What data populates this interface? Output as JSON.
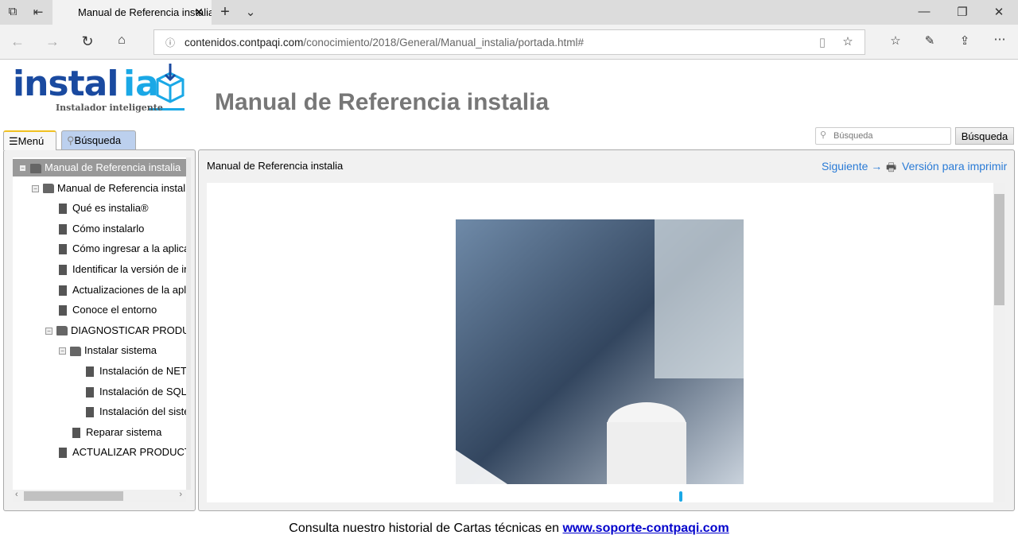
{
  "browser": {
    "tab_title": "Manual de Referencia instalia",
    "url_domain": "contenidos.contpaqi.com",
    "url_path": "/conocimiento/2018/General/Manual_instalia/portada.html#"
  },
  "logo": {
    "word": "instalia",
    "tagline": "Instalador inteligente"
  },
  "page_title": "Manual de Referencia instalia",
  "panel_tabs": {
    "menu": "Menú",
    "search": "Búsqueda"
  },
  "search": {
    "placeholder": "Búsqueda",
    "button": "Búsqueda"
  },
  "tree": [
    {
      "label": "Manual de Referencia instalia",
      "type": "book",
      "level": 0,
      "selected": true
    },
    {
      "label": "Manual de Referencia instalia",
      "type": "book",
      "level": 1
    },
    {
      "label": "Qué es instalia®",
      "type": "page",
      "level": 2
    },
    {
      "label": "Cómo instalarlo",
      "type": "page",
      "level": 2
    },
    {
      "label": "Cómo ingresar a la aplicación",
      "type": "page",
      "level": 2
    },
    {
      "label": "Identificar la versión de instalia",
      "type": "page",
      "level": 2
    },
    {
      "label": "Actualizaciones de la aplicación",
      "type": "page",
      "level": 2
    },
    {
      "label": "Conoce el entorno",
      "type": "page",
      "level": 2
    },
    {
      "label": "DIAGNOSTICAR PRODUCTOS",
      "type": "book",
      "level": 2
    },
    {
      "label": "Instalar sistema",
      "type": "book",
      "level": 3
    },
    {
      "label": "Instalación de NET",
      "type": "page",
      "level": 4
    },
    {
      "label": "Instalación de SQL",
      "type": "page",
      "level": 4
    },
    {
      "label": "Instalación del sistema",
      "type": "page",
      "level": 4
    },
    {
      "label": "Reparar sistema",
      "type": "page",
      "level": 3
    },
    {
      "label": "ACTUALIZAR PRODUCTOS",
      "type": "page",
      "level": 2
    }
  ],
  "content": {
    "breadcrumb": "Manual de Referencia instalia",
    "next": "Siguiente →",
    "print": "Versión para imprimir"
  },
  "footer": {
    "text": "Consulta nuestro historial de Cartas técnicas en ",
    "link": "www.soporte-contpaqi.com"
  }
}
